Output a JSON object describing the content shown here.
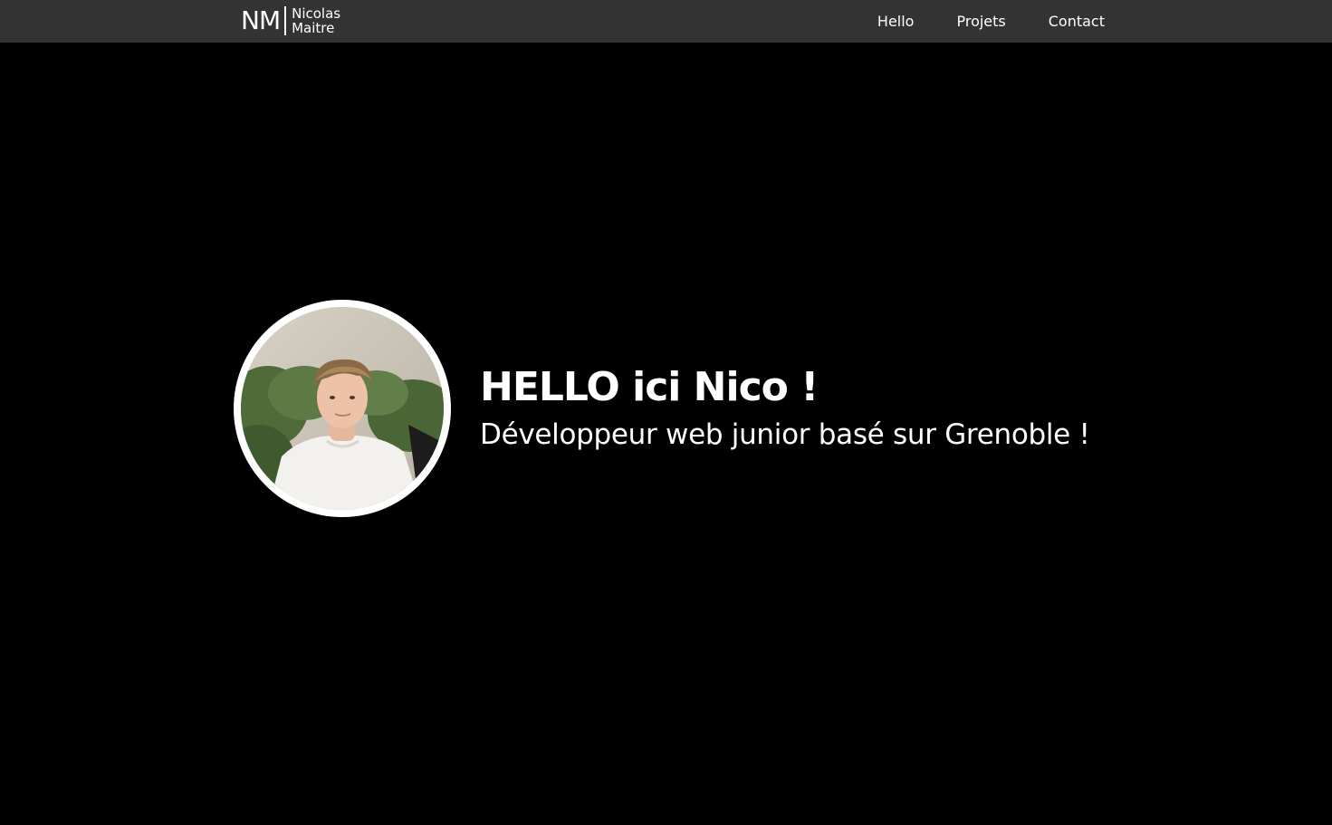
{
  "nav": {
    "logo": {
      "initials": "NM",
      "first_name": "Nicolas",
      "last_name": "Maitre"
    },
    "links": [
      {
        "label": "Hello"
      },
      {
        "label": "Projets"
      },
      {
        "label": "Contact"
      }
    ]
  },
  "hero": {
    "avatar_icon": "profile-photo",
    "title": "HELLO ici Nico !",
    "subtitle": "Développeur web junior basé sur Grenoble !"
  },
  "colors": {
    "navbar_bg": "#333333",
    "page_bg": "#000000",
    "text": "#ffffff",
    "avatar_border": "#ffffff"
  }
}
